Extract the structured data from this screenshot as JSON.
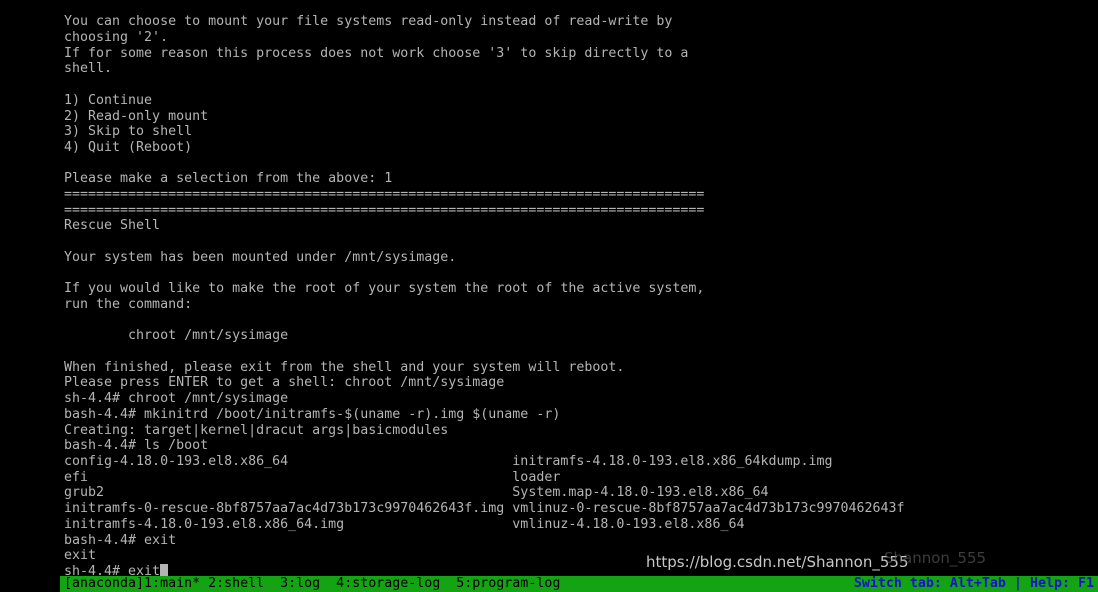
{
  "terminal": {
    "background_color": "#000000",
    "foreground_color": "#b4b4b4",
    "console_text": "You can choose to mount your file systems read-only instead of read-write by\nchoosing '2'.\nIf for some reason this process does not work choose '3' to skip directly to a\nshell.\n\n1) Continue\n2) Read-only mount\n3) Skip to shell\n4) Quit (Reboot)\n\nPlease make a selection from the above: 1\n================================================================================\n================================================================================\nRescue Shell\n\nYour system has been mounted under /mnt/sysimage.\n\nIf you would like to make the root of your system the root of the active system,\nrun the command:\n\n        chroot /mnt/sysimage\n\nWhen finished, please exit from the shell and your system will reboot.\nPlease press ENTER to get a shell: chroot /mnt/sysimage\nsh-4.4# chroot /mnt/sysimage\nbash-4.4# mkinitrd /boot/initramfs-$(uname -r).img $(uname -r)\nCreating: target|kernel|dracut args|basicmodules\nbash-4.4# ls /boot\nconfig-4.18.0-193.el8.x86_64                            initramfs-4.18.0-193.el8.x86_64kdump.img\nefi                                                     loader\ngrub2                                                   System.map-4.18.0-193.el8.x86_64\ninitramfs-0-rescue-8bf8757aa7ac4d73b173c9970462643f.img vmlinuz-0-rescue-8bf8757aa7ac4d73b173c9970462643f\ninitramfs-4.18.0-193.el8.x86_64.img                     vmlinuz-4.18.0-193.el8.x86_64\nbash-4.4# exit\nexit\nsh-4.4# exit",
    "prompt_lines": {
      "intro_1": "You can choose to mount your file systems read-only instead of read-write by",
      "intro_2": "choosing '2'.",
      "intro_3": "If for some reason this process does not work choose '3' to skip directly to a",
      "intro_4": "shell.",
      "menu_1": "1) Continue",
      "menu_2": "2) Read-only mount",
      "menu_3": "3) Skip to shell",
      "menu_4": "4) Quit (Reboot)",
      "selection_prompt": "Please make a selection from the above: 1",
      "separator": "================================================================================",
      "rescue_title": "Rescue Shell",
      "mounted_msg": "Your system has been mounted under /mnt/sysimage.",
      "root_msg_1": "If you would like to make the root of your system the root of the active system,",
      "root_msg_2": "run the command:",
      "chroot_hint": "        chroot /mnt/sysimage",
      "finish_msg": "When finished, please exit from the shell and your system will reboot.",
      "enter_msg": "Please press ENTER to get a shell: chroot /mnt/sysimage",
      "cmd_chroot": "sh-4.4# chroot /mnt/sysimage",
      "cmd_mkinitrd": "bash-4.4# mkinitrd /boot/initramfs-$(uname -r).img $(uname -r)",
      "creating_msg": "Creating: target|kernel|dracut args|basicmodules",
      "cmd_ls_boot": "bash-4.4# ls /boot",
      "cmd_exit_1": "bash-4.4# exit",
      "exit_echo": "exit",
      "cmd_exit_2": "sh-4.4# exit"
    },
    "boot_listing": {
      "left_column": [
        "config-4.18.0-193.el8.x86_64",
        "efi",
        "grub2",
        "initramfs-0-rescue-8bf8757aa7ac4d73b173c9970462643f.img",
        "initramfs-4.18.0-193.el8.x86_64.img"
      ],
      "right_column": [
        "initramfs-4.18.0-193.el8.x86_64kdump.img",
        "loader",
        "System.map-4.18.0-193.el8.x86_64",
        "vmlinuz-0-rescue-8bf8757aa7ac4d73b173c9970462643f",
        "vmlinuz-4.18.0-193.el8.x86_64"
      ]
    },
    "cursor": {
      "visible": true,
      "shape": "underscore-block"
    }
  },
  "status_bar": {
    "background_color": "#13a313",
    "text_color": "#000000",
    "hint_color": "#1515c6",
    "left_text": "[anaconda]1:main* 2:shell  3:log  4:storage-log  5:program-log",
    "right_text": "Switch tab: Alt+Tab | Help: F1",
    "tabs": [
      {
        "key": "1",
        "label": "main",
        "active": true
      },
      {
        "key": "2",
        "label": "shell",
        "active": false
      },
      {
        "key": "3",
        "label": "log",
        "active": false
      },
      {
        "key": "4",
        "label": "storage-log",
        "active": false
      },
      {
        "key": "5",
        "label": "program-log",
        "active": false
      }
    ]
  },
  "watermark": {
    "url_text": "https://blog.csdn.net/Shannon_555",
    "ghost_text": "Shannon_555"
  }
}
